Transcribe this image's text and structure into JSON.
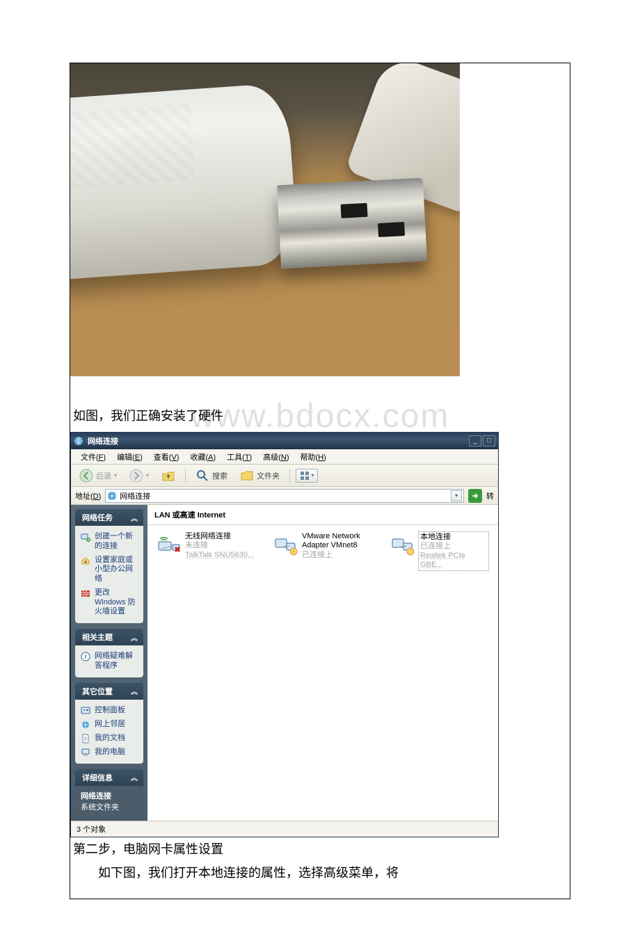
{
  "watermark": "www.bdocx.com",
  "text": {
    "line1": "如图，我们正确安装了硬件",
    "line2": "第二步，电脑网卡属性设置",
    "line3": "　　如下图，我们打开本地连接的属性，选择高级菜单，将"
  },
  "window": {
    "title": "网络连接",
    "minimize": "_",
    "maximize": "□",
    "menubar": [
      {
        "label": "文件",
        "accel": "F"
      },
      {
        "label": "编辑",
        "accel": "E"
      },
      {
        "label": "查看",
        "accel": "V"
      },
      {
        "label": "收藏",
        "accel": "A"
      },
      {
        "label": "工具",
        "accel": "T"
      },
      {
        "label": "高级",
        "accel": "N"
      },
      {
        "label": "帮助",
        "accel": "H"
      }
    ],
    "toolbar": {
      "back": "后退",
      "search": "搜索",
      "folders": "文件夹"
    },
    "addressbar": {
      "label": "地址",
      "accel": "D",
      "value": "网络连接",
      "go": "转"
    },
    "sidebar": {
      "panels": [
        {
          "title": "网络任务",
          "items": [
            {
              "icon": "new-connection-icon",
              "label": "创建一个新的连接"
            },
            {
              "icon": "home-network-icon",
              "label": "设置家庭或小型办公网络"
            },
            {
              "icon": "firewall-icon",
              "label": "更改 Windows 防火墙设置"
            }
          ]
        },
        {
          "title": "相关主题",
          "items": [
            {
              "icon": "help-icon",
              "label": "网络疑难解答程序"
            }
          ]
        },
        {
          "title": "其它位置",
          "items": [
            {
              "icon": "control-panel-icon",
              "label": "控制面板"
            },
            {
              "icon": "network-places-icon",
              "label": "网上邻居"
            },
            {
              "icon": "my-documents-icon",
              "label": "我的文档"
            },
            {
              "icon": "my-computer-icon",
              "label": "我的电脑"
            }
          ]
        },
        {
          "title": "详细信息",
          "dark": true,
          "details": {
            "name": "网络连接",
            "type": "系统文件夹"
          }
        }
      ]
    },
    "content": {
      "category": "LAN 或高速 Internet",
      "connections": [
        {
          "name": "无线网络连接",
          "status": "未连接",
          "device": "TalkTalk SNU5630...",
          "icon": "wireless-disconnected-icon"
        },
        {
          "name": "VMware Network Adapter VMnet8",
          "status": "已连接上",
          "device": "",
          "icon": "lan-connected-icon"
        },
        {
          "name": "本地连接",
          "status": "已连接上",
          "device": "Realtek PCIe GBE...",
          "icon": "lan-connected-icon",
          "selected": true
        }
      ]
    },
    "statusbar": "3 个对象"
  }
}
